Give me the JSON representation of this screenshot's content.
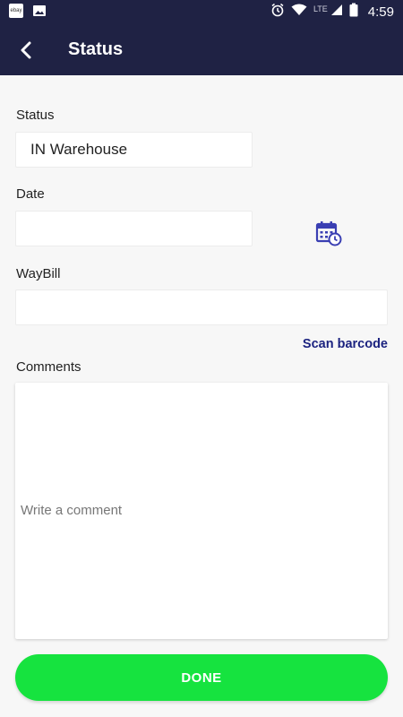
{
  "status_bar": {
    "network": "LTE",
    "time": "4:59",
    "notifications": [
      "ebay-app-icon",
      "image-icon"
    ],
    "icons": [
      "alarm-icon",
      "wifi-icon",
      "signal-icon",
      "battery-icon"
    ]
  },
  "header": {
    "title": "Status",
    "background": "#1f2244"
  },
  "form": {
    "status_label": "Status",
    "status_value": "IN Warehouse",
    "date_label": "Date",
    "date_value": "",
    "waybill_label": "WayBill",
    "waybill_value": "",
    "scan_label": "Scan barcode",
    "comments_label": "Comments",
    "comments_placeholder": "Write a comment",
    "comments_value": ""
  },
  "actions": {
    "done_label": "DONE",
    "done_color": "#16e33f"
  },
  "colors": {
    "accent": "#1c2380",
    "icon": "#3a3fb3"
  }
}
